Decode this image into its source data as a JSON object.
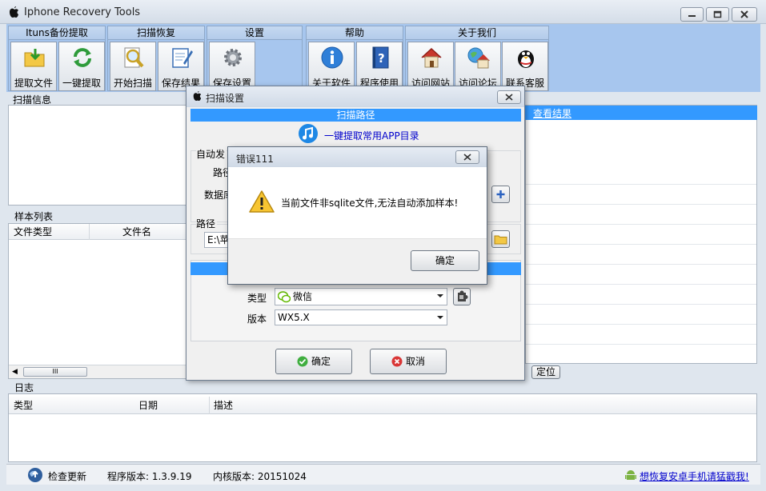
{
  "window": {
    "title": "Iphone Recovery Tools",
    "app_icon": "apple-icon"
  },
  "ribbon": {
    "groups": [
      {
        "title": "Ituns备份提取",
        "buttons": [
          {
            "label": "提取文件",
            "icon": "folder-arrow-icon"
          },
          {
            "label": "一键提取",
            "icon": "refresh-icon"
          }
        ]
      },
      {
        "title": "扫描恢复",
        "buttons": [
          {
            "label": "开始扫描",
            "icon": "magnifier-icon"
          },
          {
            "label": "保存结果",
            "icon": "notepad-icon"
          }
        ]
      },
      {
        "title": "设置",
        "buttons": [
          {
            "label": "保存设置",
            "icon": "gear-icon"
          }
        ]
      },
      {
        "title": "帮助",
        "buttons": [
          {
            "label": "关于软件",
            "icon": "info-icon"
          },
          {
            "label": "程序使用",
            "icon": "help-book-icon"
          }
        ]
      },
      {
        "title": "关于我们",
        "buttons": [
          {
            "label": "访问网站",
            "icon": "house-icon"
          },
          {
            "label": "访问论坛",
            "icon": "globe-house-icon"
          },
          {
            "label": "联系客服",
            "icon": "penguin-icon"
          }
        ]
      }
    ]
  },
  "main": {
    "scan_info_label": "扫描信息",
    "sample_list_label": "样本列表",
    "sample_columns": [
      "文件类型",
      "文件名"
    ],
    "view_results_link": "查看结果",
    "locate_button": "定位",
    "scroll_thumb": "III",
    "log_label": "日志",
    "log_columns": [
      "类型",
      "日期",
      "描述"
    ]
  },
  "status": {
    "check_update": "检查更新",
    "program_version": "程序版本: 1.3.9.19",
    "kernel_version": "内核版本: 20151024",
    "android_link": "想恢复安卓手机请猛戳我!"
  },
  "scan_dialog": {
    "title": "扫描设置",
    "path_header": "扫描路径",
    "one_click_link": "一键提取常用APP目录",
    "auto_label_partial": "自动发",
    "path_label_partial": "路径",
    "db_label_partial": "数据库",
    "path_label": "路径",
    "path_value_partial": "E:\\苹",
    "type_label": "类型",
    "type_value": "微信",
    "version_label": "版本",
    "version_value": "WX5.X",
    "ok_button": "确定",
    "cancel_button": "取消"
  },
  "error_dialog": {
    "title": "错误111",
    "message": "当前文件非sqlite文件,无法自动添加样本!",
    "ok_button": "确定"
  }
}
